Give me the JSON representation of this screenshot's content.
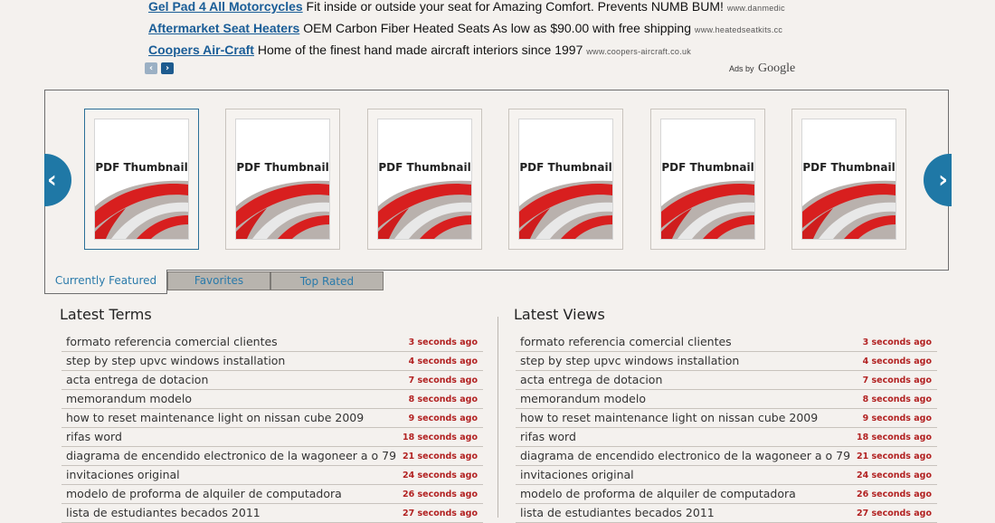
{
  "ads": [
    {
      "title": "Gel Pad 4 All Motorcycles",
      "text": "Fit inside or outside your seat for Amazing Comfort. Prevents NUMB BUM!",
      "url": "www.danmedic"
    },
    {
      "title": "Aftermarket Seat Heaters",
      "text": "OEM Carbon Fiber Heated Seats As low as $90.00 with free shipping",
      "url": "www.heatedseatkits.cc"
    },
    {
      "title": "Coopers Air-Craft",
      "text": "Home of the finest hand made aircraft interiors since 1997",
      "url": "www.coopers-aircraft.co.uk"
    }
  ],
  "ad_nav": {
    "prev": "‹",
    "next": "›"
  },
  "ads_by": {
    "label": "Ads by",
    "brand": "Google"
  },
  "carousel": {
    "prev_arrow": "‹",
    "next_arrow": "›",
    "thumbnails": [
      {
        "label": "PDF Thumbnail"
      },
      {
        "label": "PDF Thumbnail"
      },
      {
        "label": "PDF Thumbnail"
      },
      {
        "label": "PDF Thumbnail"
      },
      {
        "label": "PDF Thumbnail"
      },
      {
        "label": "PDF Thumbnail"
      }
    ]
  },
  "tabs": {
    "featured": "Currently Featured",
    "favorites": "Favorites",
    "top_rated": "Top Rated"
  },
  "latest_terms": {
    "title": "Latest Terms",
    "rows": [
      {
        "text": "formato referencia comercial clientes",
        "time": "3 seconds ago"
      },
      {
        "text": "step by step upvc windows installation",
        "time": "4 seconds ago"
      },
      {
        "text": "acta entrega de dotacion",
        "time": "7 seconds ago"
      },
      {
        "text": "memorandum modelo",
        "time": "8 seconds ago"
      },
      {
        "text": "how to reset maintenance light on nissan cube 2009",
        "time": "9 seconds ago"
      },
      {
        "text": "rifas word",
        "time": "18 seconds ago"
      },
      {
        "text": "diagrama de encendido electronico de la wagoneer a o 79",
        "time": "21 seconds ago"
      },
      {
        "text": "invitaciones original",
        "time": "24 seconds ago"
      },
      {
        "text": "modelo de proforma de alquiler de computadora",
        "time": "26 seconds ago"
      },
      {
        "text": "lista de estudiantes becados 2011",
        "time": "27 seconds ago"
      }
    ]
  },
  "latest_views": {
    "title": "Latest Views",
    "rows": [
      {
        "text": "formato referencia comercial clientes",
        "time": "3 seconds ago"
      },
      {
        "text": "step by step upvc windows installation",
        "time": "4 seconds ago"
      },
      {
        "text": "acta entrega de dotacion",
        "time": "7 seconds ago"
      },
      {
        "text": "memorandum modelo",
        "time": "8 seconds ago"
      },
      {
        "text": "how to reset maintenance light on nissan cube 2009",
        "time": "9 seconds ago"
      },
      {
        "text": "rifas word",
        "time": "18 seconds ago"
      },
      {
        "text": "diagrama de encendido electronico de la wagoneer a o 79",
        "time": "21 seconds ago"
      },
      {
        "text": "invitaciones original",
        "time": "24 seconds ago"
      },
      {
        "text": "modelo de proforma de alquiler de computadora",
        "time": "26 seconds ago"
      },
      {
        "text": "lista de estudiantes becados 2011",
        "time": "27 seconds ago"
      }
    ]
  },
  "colors": {
    "accent": "#1f78a6",
    "time_red": "#b22222",
    "ad_link": "#1a5d97"
  }
}
